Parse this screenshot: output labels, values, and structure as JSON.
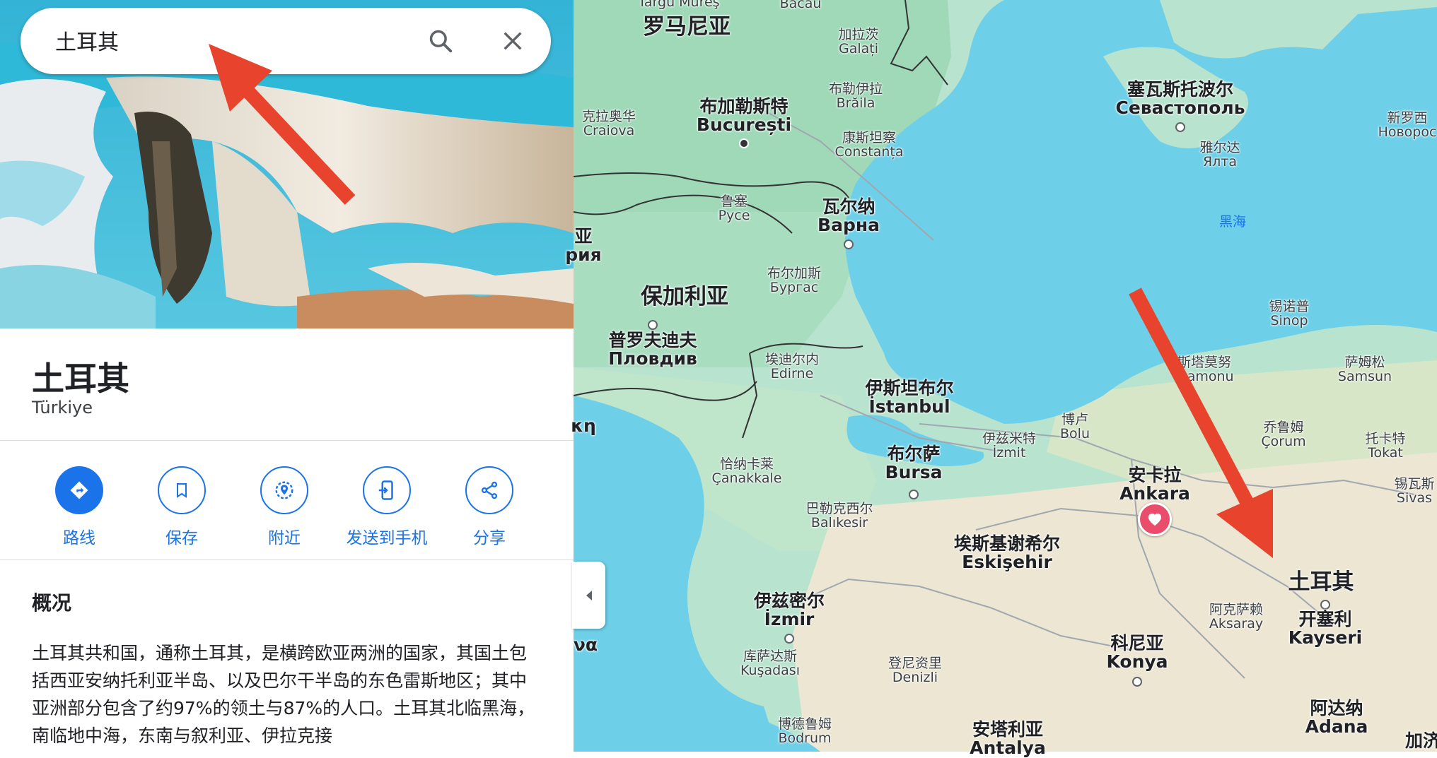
{
  "search": {
    "query": "土耳其"
  },
  "place": {
    "name": "土耳其",
    "native_name": "Türkiye"
  },
  "actions": [
    {
      "label": "路线",
      "icon": "directions-icon"
    },
    {
      "label": "保存",
      "icon": "bookmark-icon"
    },
    {
      "label": "附近",
      "icon": "nearby-icon"
    },
    {
      "label": "发送到手机",
      "icon": "send-to-phone-icon"
    },
    {
      "label": "分享",
      "icon": "share-icon"
    }
  ],
  "overview": {
    "heading": "概况",
    "text": "土耳其共和国，通称土耳其，是横跨欧亚两洲的国家，其国土包括西亚安纳托利亚半岛、以及巴尔干半岛的东色雷斯地区；其中亚洲部分包含了约97%的领土与87%的人口。土耳其北临黑海，南临地中海，东南与叙利亚、伊拉克接"
  },
  "map_labels": {
    "romania": "罗马尼亚",
    "bacau": "Bacău",
    "galati": [
      "加拉茨",
      "Galați"
    ],
    "braila": [
      "布勒伊拉",
      "Brăila"
    ],
    "bucharest": [
      "布加勒斯特",
      "București"
    ],
    "craiova": [
      "克拉奥华",
      "Craiova"
    ],
    "constanta": [
      "康斯坦察",
      "Constanța"
    ],
    "sevastopol": [
      "塞瓦斯托波尔",
      "Севастополь"
    ],
    "yalta": [
      "雅尔达",
      "Ялта"
    ],
    "novoros": [
      "新罗西",
      "Новорос"
    ],
    "ruse": [
      "鲁塞",
      "Русе"
    ],
    "varna": [
      "瓦尔纳",
      "Варна"
    ],
    "black_sea": "黑海",
    "left_partial": [
      "亚",
      "рия"
    ],
    "burgas": [
      "布尔加斯",
      "Бургас"
    ],
    "bulgaria": "保加利亚",
    "sinop": [
      "锡诺普",
      "Sinop"
    ],
    "plovdiv": [
      "普罗夫迪夫",
      "Пловдив"
    ],
    "edirne": [
      "埃迪尔内",
      "Edirne"
    ],
    "kastamonu": [
      "斯塔莫努",
      "stamonu"
    ],
    "samsun": [
      "萨姆松",
      "Samsun"
    ],
    "istanbul": [
      "伊斯坦布尔",
      "İstanbul"
    ],
    "left_kη": "κη",
    "bolu": [
      "博卢",
      "Bolu"
    ],
    "izmit": [
      "伊兹米特",
      "İzmit"
    ],
    "corum": [
      "乔鲁姆",
      "Çorum"
    ],
    "tokat": [
      "托卡特",
      "Tokat"
    ],
    "bursa": [
      "布尔萨",
      "Bursa"
    ],
    "canakkale": [
      "恰纳卡莱",
      "Çanakkale"
    ],
    "ankara": [
      "安卡拉",
      "Ankara"
    ],
    "sivas": [
      "锡瓦斯",
      "Sivas"
    ],
    "balikesir": [
      "巴勒克西尔",
      "Balıkesir"
    ],
    "eskisehir": [
      "埃斯基谢希尔",
      "Eskişehir"
    ],
    "turkey": "土耳其",
    "izmir": [
      "伊兹密尔",
      "İzmir"
    ],
    "aksaray": [
      "阿克萨赖",
      "Aksaray"
    ],
    "kayseri": [
      "开塞利",
      "Kayseri"
    ],
    "kusadasi": [
      "库萨达斯",
      "Kuşadası"
    ],
    "konya": [
      "科尼亚",
      "Konya"
    ],
    "denizli": [
      "登尼资里",
      "Denizli"
    ],
    "left_va": "να",
    "adana": [
      "阿达纳",
      "Adana"
    ],
    "bodrum": [
      "博德鲁姆",
      "Bodrum"
    ],
    "antalya": [
      "安塔利亚",
      "Antalya"
    ],
    "right_partial": "加济",
    "top_partial": "Targu Mureş"
  }
}
